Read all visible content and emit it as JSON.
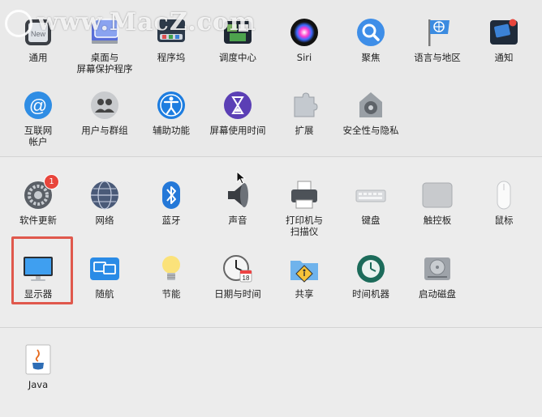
{
  "watermark": "www.MacZ.com",
  "badge_count": "1",
  "colors": {
    "highlight": "#e0584c",
    "badge": "#e8453c"
  },
  "row1": [
    {
      "id": "general",
      "label": "通用",
      "icon": "general-icon"
    },
    {
      "id": "desktop",
      "label": "桌面与\n屏幕保护程序",
      "icon": "desktop-screensaver-icon"
    },
    {
      "id": "dock",
      "label": "程序坞",
      "icon": "dock-icon"
    },
    {
      "id": "mission",
      "label": "调度中心",
      "icon": "mission-control-icon"
    },
    {
      "id": "siri",
      "label": "Siri",
      "icon": "siri-icon"
    },
    {
      "id": "spotlight",
      "label": "聚焦",
      "icon": "spotlight-icon"
    },
    {
      "id": "language",
      "label": "语言与地区",
      "icon": "language-region-icon"
    },
    {
      "id": "notifications",
      "label": "通知",
      "icon": "notifications-icon"
    }
  ],
  "row2": [
    {
      "id": "internet",
      "label": "互联网\n帐户",
      "icon": "internet-accounts-icon"
    },
    {
      "id": "users",
      "label": "用户与群组",
      "icon": "users-groups-icon"
    },
    {
      "id": "accessibility",
      "label": "辅助功能",
      "icon": "accessibility-icon"
    },
    {
      "id": "screentime",
      "label": "屏幕使用时间",
      "icon": "screen-time-icon"
    },
    {
      "id": "extensions",
      "label": "扩展",
      "icon": "extensions-icon"
    },
    {
      "id": "security",
      "label": "安全性与隐私",
      "icon": "security-privacy-icon"
    }
  ],
  "row3": [
    {
      "id": "update",
      "label": "软件更新",
      "icon": "software-update-icon"
    },
    {
      "id": "network",
      "label": "网络",
      "icon": "network-icon"
    },
    {
      "id": "bluetooth",
      "label": "蓝牙",
      "icon": "bluetooth-icon"
    },
    {
      "id": "sound",
      "label": "声音",
      "icon": "sound-icon"
    },
    {
      "id": "printers",
      "label": "打印机与\n扫描仪",
      "icon": "printers-scanners-icon"
    },
    {
      "id": "keyboard",
      "label": "键盘",
      "icon": "keyboard-icon"
    },
    {
      "id": "trackpad",
      "label": "触控板",
      "icon": "trackpad-icon"
    },
    {
      "id": "mouse",
      "label": "鼠标",
      "icon": "mouse-icon"
    }
  ],
  "row4": [
    {
      "id": "displays",
      "label": "显示器",
      "icon": "displays-icon"
    },
    {
      "id": "sidecar",
      "label": "随航",
      "icon": "sidecar-icon"
    },
    {
      "id": "energy",
      "label": "节能",
      "icon": "energy-saver-icon"
    },
    {
      "id": "datetime",
      "label": "日期与时间",
      "icon": "date-time-icon"
    },
    {
      "id": "sharing",
      "label": "共享",
      "icon": "sharing-icon"
    },
    {
      "id": "timemachine",
      "label": "时间机器",
      "icon": "time-machine-icon"
    },
    {
      "id": "startup",
      "label": "启动磁盘",
      "icon": "startup-disk-icon"
    }
  ],
  "row5": [
    {
      "id": "java",
      "label": "Java",
      "icon": "java-icon"
    }
  ]
}
